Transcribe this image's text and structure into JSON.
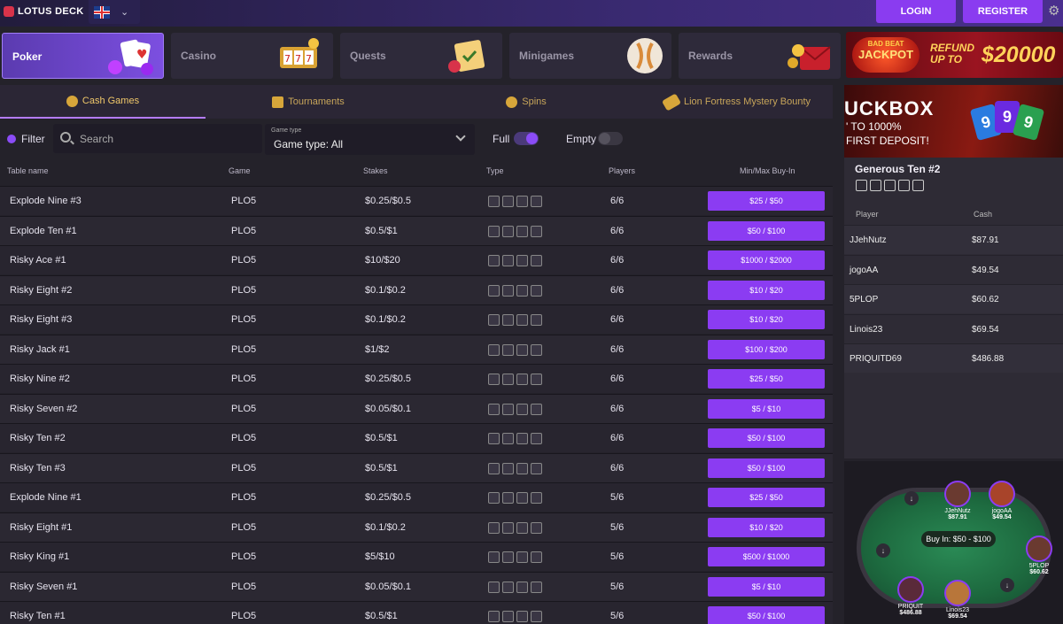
{
  "header": {
    "logo": "LOTUS DECK",
    "login": "LOGIN",
    "register": "REGISTER"
  },
  "categories": [
    {
      "label": "Poker"
    },
    {
      "label": "Casino"
    },
    {
      "label": "Quests"
    },
    {
      "label": "Minigames"
    },
    {
      "label": "Rewards"
    }
  ],
  "promo": {
    "jackpot_top": "BAD BEAT",
    "jackpot_main": "JACKPOT",
    "refund_line1": "REFUND",
    "refund_line2": "UP TO",
    "refund_amount": "$20000"
  },
  "subtabs": [
    {
      "label": "Cash Games"
    },
    {
      "label": "Tournaments"
    },
    {
      "label": "Spins"
    },
    {
      "label": "Lion Fortress Mystery Bounty"
    }
  ],
  "filters": {
    "filter_label": "Filter",
    "search_placeholder": "Search",
    "game_type_caption": "Game type",
    "game_type_value": "Game type: All",
    "full_label": "Full",
    "empty_label": "Empty"
  },
  "table": {
    "headers": {
      "name": "Table name",
      "game": "Game",
      "stakes": "Stakes",
      "type": "Type",
      "players": "Players",
      "buyin": "Min/Max Buy-In"
    },
    "rows": [
      {
        "name": "Explode Nine #3",
        "game": "PLO5",
        "stakes": "$0.25/$0.5",
        "players": "6/6",
        "buyin": "$25 / $50"
      },
      {
        "name": "Explode Ten #1",
        "game": "PLO5",
        "stakes": "$0.5/$1",
        "players": "6/6",
        "buyin": "$50 / $100"
      },
      {
        "name": "Risky Ace #1",
        "game": "PLO5",
        "stakes": "$10/$20",
        "players": "6/6",
        "buyin": "$1000 / $2000"
      },
      {
        "name": "Risky Eight #2",
        "game": "PLO5",
        "stakes": "$0.1/$0.2",
        "players": "6/6",
        "buyin": "$10 / $20"
      },
      {
        "name": "Risky Eight #3",
        "game": "PLO5",
        "stakes": "$0.1/$0.2",
        "players": "6/6",
        "buyin": "$10 / $20"
      },
      {
        "name": "Risky Jack #1",
        "game": "PLO5",
        "stakes": "$1/$2",
        "players": "6/6",
        "buyin": "$100 / $200"
      },
      {
        "name": "Risky Nine #2",
        "game": "PLO5",
        "stakes": "$0.25/$0.5",
        "players": "6/6",
        "buyin": "$25 / $50"
      },
      {
        "name": "Risky Seven #2",
        "game": "PLO5",
        "stakes": "$0.05/$0.1",
        "players": "6/6",
        "buyin": "$5 / $10"
      },
      {
        "name": "Risky Ten #2",
        "game": "PLO5",
        "stakes": "$0.5/$1",
        "players": "6/6",
        "buyin": "$50 / $100"
      },
      {
        "name": "Risky Ten #3",
        "game": "PLO5",
        "stakes": "$0.5/$1",
        "players": "6/6",
        "buyin": "$50 / $100"
      },
      {
        "name": "Explode Nine #1",
        "game": "PLO5",
        "stakes": "$0.25/$0.5",
        "players": "5/6",
        "buyin": "$25 / $50"
      },
      {
        "name": "Risky Eight #1",
        "game": "PLO5",
        "stakes": "$0.1/$0.2",
        "players": "5/6",
        "buyin": "$10 / $20"
      },
      {
        "name": "Risky King #1",
        "game": "PLO5",
        "stakes": "$5/$10",
        "players": "5/6",
        "buyin": "$500 / $1000"
      },
      {
        "name": "Risky Seven #1",
        "game": "PLO5",
        "stakes": "$0.05/$0.1",
        "players": "5/6",
        "buyin": "$5 / $10"
      },
      {
        "name": "Risky Ten #1",
        "game": "PLO5",
        "stakes": "$0.5/$1",
        "players": "5/6",
        "buyin": "$50 / $100"
      }
    ]
  },
  "side_banner": {
    "title": "UCKBOX",
    "line1": "' TO 1000%",
    "line2": "FIRST DEPOSIT!",
    "cards": [
      "9",
      "9",
      "9"
    ]
  },
  "selected_table": {
    "title": "Generous Ten #2",
    "col_player": "Player",
    "col_cash": "Cash",
    "players": [
      {
        "name": "JJehNutz",
        "cash": "$87.91"
      },
      {
        "name": "jogoAA",
        "cash": "$49.54"
      },
      {
        "name": "5PLOP",
        "cash": "$60.62"
      },
      {
        "name": "Linois23",
        "cash": "$69.54"
      },
      {
        "name": "PRIQUITD69",
        "cash": "$486.88"
      }
    ]
  },
  "table_view": {
    "buy_in": "Buy In: $50 - $100",
    "seats": [
      {
        "name": "JJehNutz",
        "cash": "$87.91"
      },
      {
        "name": "jogoAA",
        "cash": "$49.54"
      },
      {
        "name": "5PLOP",
        "cash": "$60.62"
      },
      {
        "name": "PRIQUIT",
        "cash": "$486.88"
      },
      {
        "name": "Linois23",
        "cash": "$69.54"
      }
    ]
  }
}
